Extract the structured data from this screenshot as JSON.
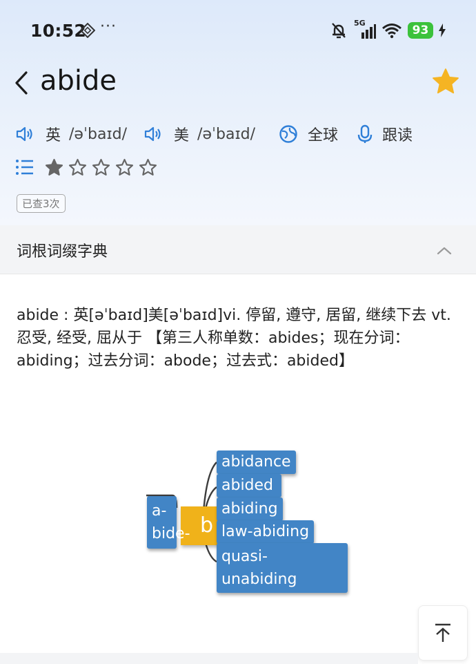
{
  "status_bar": {
    "time": "10:52",
    "more": "···",
    "network": "5G",
    "battery": "93"
  },
  "header": {
    "title": "abide",
    "favorite_color": "#f5b423"
  },
  "pronunciation": {
    "uk": {
      "label": "英",
      "ipa": "/əˈbaɪd/"
    },
    "us": {
      "label": "美",
      "ipa": "/əˈbaɪd/"
    },
    "global_label": "全球",
    "follow_label": "跟读",
    "accent_color": "#2f7fd8"
  },
  "rating": {
    "value": 1,
    "max": 5
  },
  "lookup_count_label": "已查3次",
  "section": {
    "title": "词根词缀字典"
  },
  "definition": {
    "text": "abide : 英[əˈbaɪd]美[əˈbaɪd]vi. 停留, 遵守, 居留, 继续下去 vt. 忍受, 经受, 屈从于 【第三人称单数：abides；现在分词：abiding；过去分词：abode；过去式：abided】"
  },
  "mindmap": {
    "root": "b",
    "left_node": "a-\nbide-",
    "children": [
      "abidance",
      "abided",
      "abiding",
      "law-abiding",
      "quasi-\nunabiding"
    ],
    "node_color": "#4285c6",
    "root_color": "#f0b21a"
  }
}
